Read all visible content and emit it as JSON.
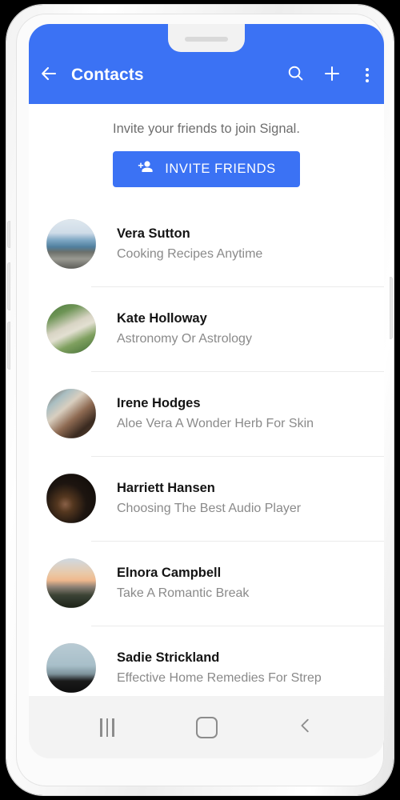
{
  "app_bar": {
    "title": "Contacts",
    "back_icon": "arrow-left-icon",
    "actions": [
      {
        "name": "search-icon",
        "label": "Search"
      },
      {
        "name": "add-contact-icon",
        "label": "Add"
      },
      {
        "name": "overflow-menu-icon",
        "label": "More options"
      }
    ],
    "background_color": "#3b72f4"
  },
  "invite": {
    "message": "Invite your friends to join Signal.",
    "button_label": "INVITE FRIENDS",
    "button_icon": "person-add-icon",
    "button_color": "#3b72f4"
  },
  "contacts": [
    {
      "name": "Vera Sutton",
      "subtitle": "Cooking Recipes Anytime"
    },
    {
      "name": "Kate Holloway",
      "subtitle": "Astronomy Or Astrology"
    },
    {
      "name": "Irene Hodges",
      "subtitle": "Aloe Vera A Wonder Herb For Skin"
    },
    {
      "name": "Harriett Hansen",
      "subtitle": "Choosing The Best Audio Player"
    },
    {
      "name": "Elnora Campbell",
      "subtitle": "Take A Romantic Break"
    },
    {
      "name": "Sadie Strickland",
      "subtitle": "Effective Home Remedies For Strep"
    }
  ],
  "nav_bar": {
    "recents": "recents-icon",
    "home": "home-icon",
    "back": "back-chevron-icon"
  }
}
